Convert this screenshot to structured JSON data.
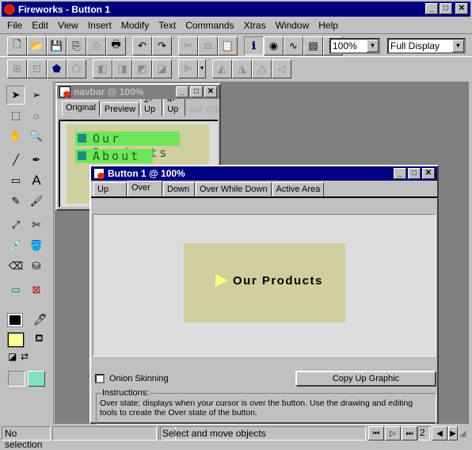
{
  "app": {
    "title": "Fireworks - Button 1"
  },
  "menu": [
    "File",
    "Edit",
    "View",
    "Insert",
    "Modify",
    "Text",
    "Commands",
    "Xtras",
    "Window",
    "Help"
  ],
  "toolbar": {
    "zoom": "100%",
    "display": "Full Display"
  },
  "navbar_window": {
    "title": "navbar @  100%",
    "tabs": [
      "Original",
      "Preview",
      "2-Up",
      "4-Up"
    ],
    "format": "GIF (Slice Fr",
    "items": [
      "Our Products",
      "About Us"
    ]
  },
  "button_window": {
    "title": "Button 1 @  100%",
    "tabs": [
      "Up",
      "Over",
      "Down",
      "Over While Down",
      "Active Area"
    ],
    "active_tab": "Over",
    "canvas_text": "Our Products",
    "onion_label": "Onion Skinning",
    "onion_checked": false,
    "copy_button": "Copy Up Graphic",
    "instructions_label": "Instructions:",
    "instructions": "Over state: displays when your cursor is over the button. Use the drawing and editing tools to create the Over state of the button."
  },
  "status": {
    "selection": "No selection",
    "message": "Select and move objects",
    "frame": "2"
  },
  "colors": {
    "title_active": "#000080",
    "canvas": "#cfcf9f",
    "nav_highlight": "#6ee65a",
    "fill": "#ffff99",
    "stroke": "#000000"
  }
}
